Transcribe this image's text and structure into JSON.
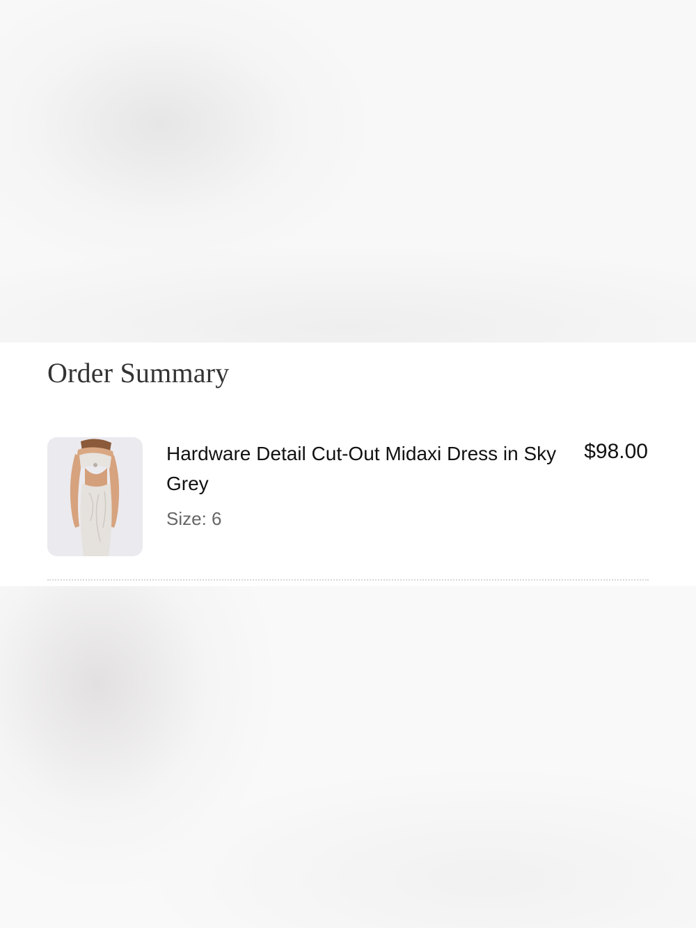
{
  "order_summary": {
    "title": "Order Summary",
    "items": [
      {
        "name": "Hardware Detail Cut-Out Midaxi Dress in Sky Grey",
        "size": "Size: 6",
        "price": "$98.00",
        "image_icon": "dress-product-photo"
      }
    ]
  },
  "colors": {
    "background": "#ffffff",
    "text_primary": "#111111",
    "text_secondary": "#666666",
    "thumb_background": "#ebeaef"
  }
}
